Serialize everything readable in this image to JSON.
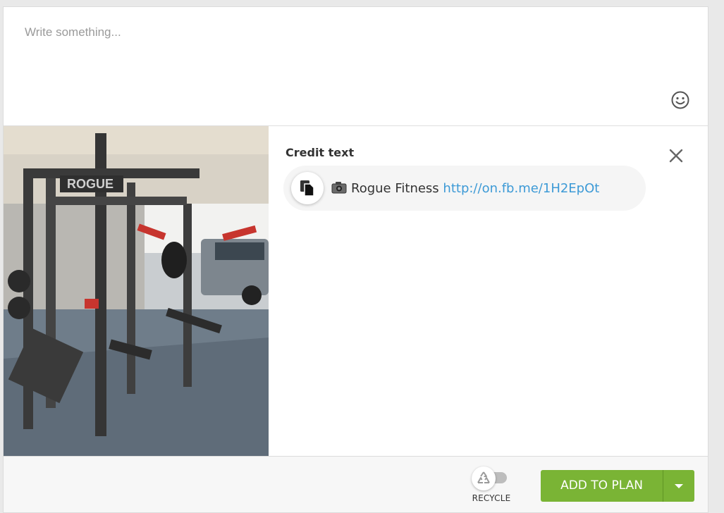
{
  "composer": {
    "placeholder": "Write something..."
  },
  "media": {
    "photo_alt": "ROGUE"
  },
  "credit": {
    "label": "Credit text",
    "name": "Rogue Fitness",
    "link": "http://on.fb.me/1H2EpOt"
  },
  "footer": {
    "recycle_label": "RECYCLE",
    "add_label": "ADD TO PLAN"
  },
  "colors": {
    "accent": "#7ab435",
    "link": "#3d9ad6"
  },
  "icons": [
    "smile-icon",
    "close-icon",
    "copy-icon",
    "camera-icon",
    "recycle-icon",
    "caret-down-icon"
  ]
}
